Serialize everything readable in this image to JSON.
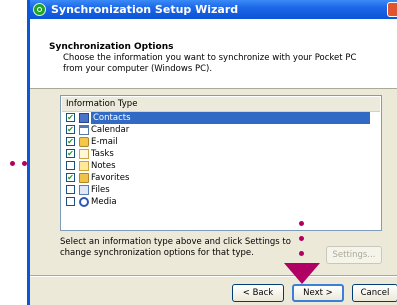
{
  "window": {
    "title": "Synchronization Setup Wizard"
  },
  "header": {
    "title": "Synchronization Options",
    "description": "Choose the information you want to synchronize with your Pocket PC from your computer (Windows PC)."
  },
  "list": {
    "column_header": "Information Type",
    "items": [
      {
        "label": "Contacts",
        "checked": true,
        "selected": true,
        "icon": "contacts-icon"
      },
      {
        "label": "Calendar",
        "checked": true,
        "selected": false,
        "icon": "calendar-icon"
      },
      {
        "label": "E-mail",
        "checked": true,
        "selected": false,
        "icon": "email-icon"
      },
      {
        "label": "Tasks",
        "checked": true,
        "selected": false,
        "icon": "tasks-icon"
      },
      {
        "label": "Notes",
        "checked": false,
        "selected": false,
        "icon": "notes-icon"
      },
      {
        "label": "Favorites",
        "checked": true,
        "selected": false,
        "icon": "favorites-icon"
      },
      {
        "label": "Files",
        "checked": false,
        "selected": false,
        "icon": "files-icon"
      },
      {
        "label": "Media",
        "checked": false,
        "selected": false,
        "icon": "media-icon"
      }
    ]
  },
  "info": "Select an information type above and click Settings to change synchronization options for that type.",
  "buttons": {
    "settings": "Settings...",
    "back": "< Back",
    "next": "Next >",
    "cancel": "Cancel"
  },
  "colors": {
    "title_bar": "#0b53d6",
    "selection": "#316ac5",
    "annotation": "#b00063"
  }
}
